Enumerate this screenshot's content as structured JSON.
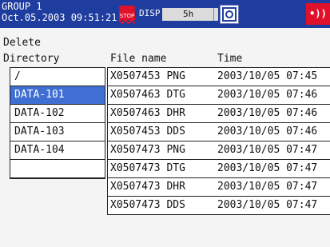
{
  "status_bar": {
    "group": "GROUP 1",
    "datetime": "Oct.05.2003 09:51:21",
    "stop_icon": "stop-icon",
    "disp_label": "DISP",
    "disp_value": "5h",
    "media_icon": "media-icon",
    "alarm_icon": "alarm-icon"
  },
  "screen": {
    "title": "Delete",
    "directory_label": "Directory",
    "file_name_header": "File name",
    "time_header": "Time"
  },
  "directories": [
    "/",
    "DATA-101",
    "DATA-102",
    "DATA-103",
    "DATA-104",
    ""
  ],
  "selected_directory": "DATA-101",
  "files": [
    {
      "name": "X0507453 PNG",
      "time": "2003/10/05 07:45"
    },
    {
      "name": "X0507463 DTG",
      "time": "2003/10/05 07:46"
    },
    {
      "name": "X0507463 DHR",
      "time": "2003/10/05 07:46"
    },
    {
      "name": "X0507453 DDS",
      "time": "2003/10/05 07:46"
    },
    {
      "name": "X0507473 PNG",
      "time": "2003/10/05 07:47"
    },
    {
      "name": "X0507473 DTG",
      "time": "2003/10/05 07:47"
    },
    {
      "name": "X0507473 DHR",
      "time": "2003/10/05 07:47"
    },
    {
      "name": "X0507473 DDS",
      "time": "2003/10/05 07:47"
    }
  ],
  "colors": {
    "status_bar_bg": "#1f3d9e",
    "selection": "#3f6fd2",
    "alarm": "#e0122b",
    "stop_icon": "#e0122b"
  }
}
